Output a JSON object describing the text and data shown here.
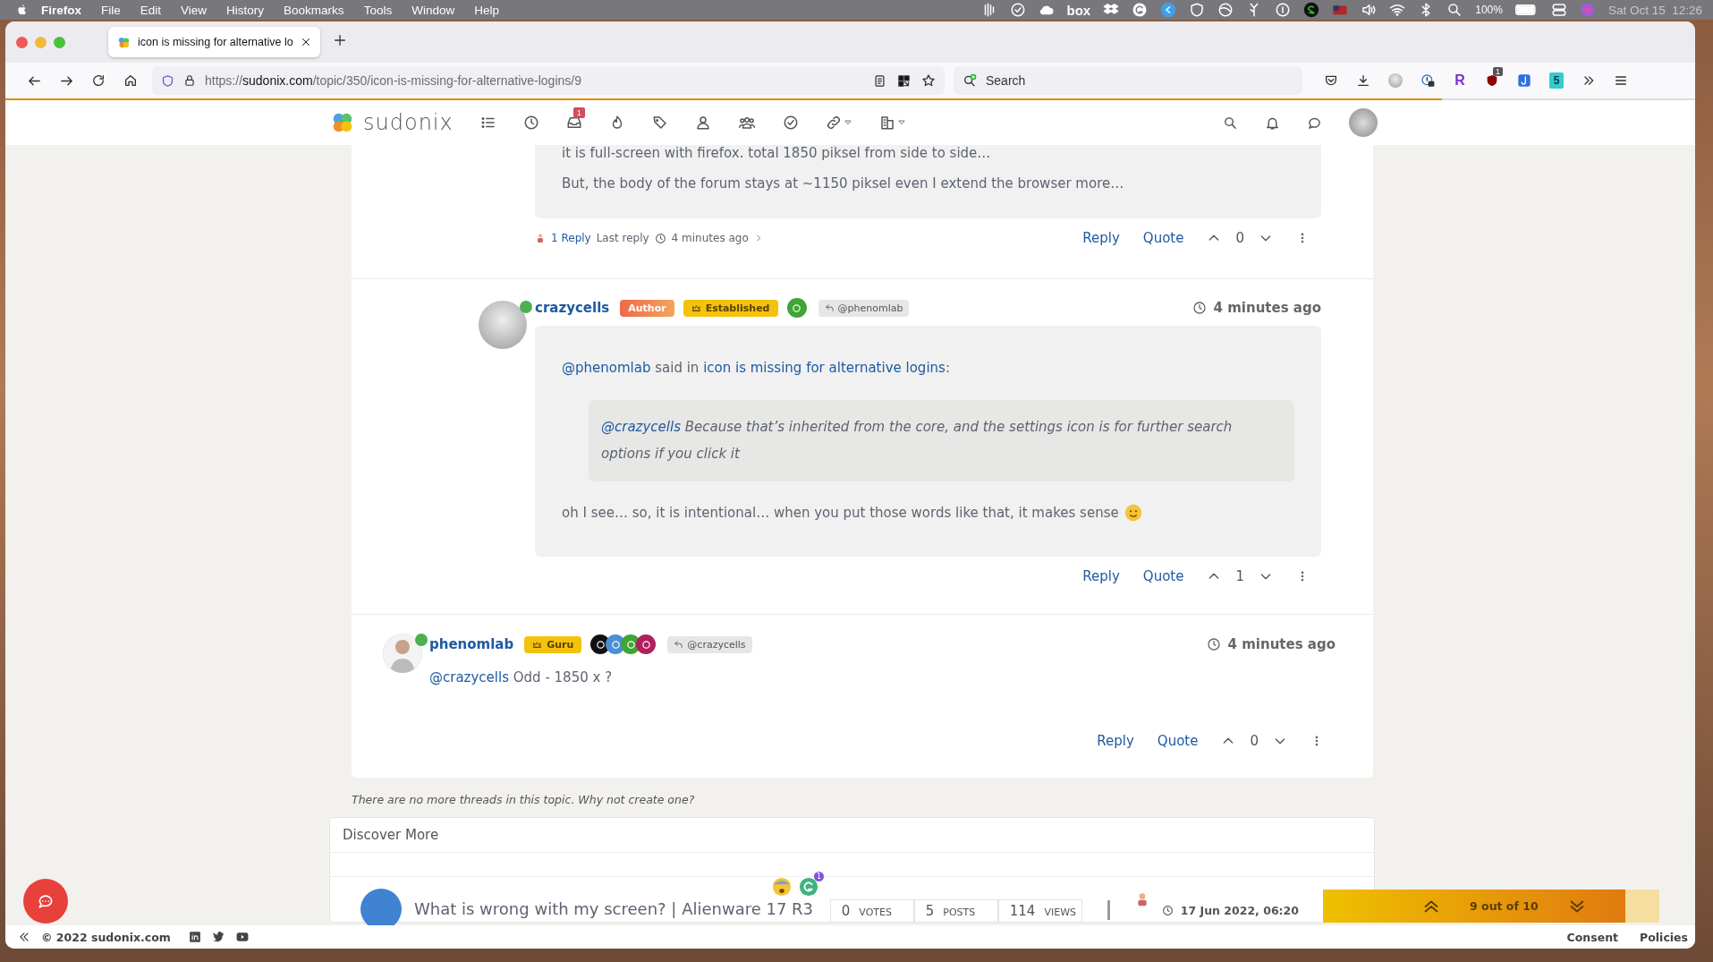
{
  "menubar": {
    "app": "Firefox",
    "menus": [
      "File",
      "Edit",
      "View",
      "History",
      "Bookmarks",
      "Tools",
      "Window",
      "Help"
    ],
    "box_label": "box",
    "battery": "100%",
    "clock": "Sat Oct 15  12:26"
  },
  "browser": {
    "tabs": [
      {
        "title": "icon is missing for alternative lo",
        "selected": true
      }
    ],
    "url": {
      "scheme": "https://",
      "host": "sudonix.com",
      "path": "/topic/350/icon-is-missing-for-alternative-logins/9"
    },
    "search": {
      "placeholder": "Search"
    },
    "extensions": {
      "r_label": "R",
      "badge": "1",
      "five_label": "5"
    },
    "load_progress": {
      "level": 0.85
    }
  },
  "site": {
    "brand": "sudonix",
    "inbox_badge": "1"
  },
  "posts": [
    {
      "kind": "continued",
      "paragraphs": [
        "it is full-screen with firefox. total 1850 piksel from side to side…",
        "But, the body of the forum stays at ~1150 piksel even I extend the browser more…"
      ],
      "replies": "1 Reply",
      "last_reply": "Last reply",
      "last_time": "4 minutes ago",
      "reply": "Reply",
      "quote": "Quote",
      "votes": "0"
    },
    {
      "kind": "bubble",
      "author": "crazycells",
      "online": true,
      "badges": [
        {
          "kind": "author",
          "label": "Author"
        },
        {
          "kind": "rank",
          "label": "Established"
        }
      ],
      "group_icons": [
        {
          "color": "#3fa535"
        }
      ],
      "reply_to": "@phenomlab",
      "time": "4 minutes ago",
      "attribution": {
        "mention": "@phenomlab",
        "middle": "said in",
        "topic": "icon is missing for alternative logins",
        "end": ":"
      },
      "blockquote": {
        "mention": "@crazycells",
        "text": "Because that’s inherited from the core, and the settings icon is for further search options if you click it"
      },
      "text": "oh I see… so, it is intentional… when you put those words like that, it makes sense",
      "smiley": true,
      "reply": "Reply",
      "quote": "Quote",
      "votes": "1"
    },
    {
      "kind": "plain",
      "author": "phenomlab",
      "online": true,
      "badges": [
        {
          "kind": "rank",
          "label": "Guru"
        }
      ],
      "group_icons": [
        {
          "color": "#111111"
        },
        {
          "color": "#4a8fd8"
        },
        {
          "color": "#3fa535"
        },
        {
          "color": "#b01f5e"
        }
      ],
      "reply_to": "@crazycells",
      "time": "4 minutes ago",
      "mention": "@crazycells",
      "text": "Odd - 1850 x ?",
      "reply": "Reply",
      "quote": "Quote",
      "votes": "0"
    }
  ],
  "notice": "There are no more threads in this topic. Why not create one?",
  "discover": {
    "title": "Discover More",
    "topics": [
      {
        "title": "What is wrong with my screen? | Alienware 17 R3",
        "reaction_count": "1",
        "stats": [
          {
            "value": "0",
            "label": "VOTES"
          },
          {
            "value": "5",
            "label": "POSTS"
          },
          {
            "value": "114",
            "label": "VIEWS"
          }
        ],
        "time": "17 Jun 2022, 06:20"
      }
    ]
  },
  "pager": {
    "label": "9 out of 10",
    "level": 0.9
  },
  "footer": {
    "copyright": "© 2022 sudonix.com",
    "links": [
      "Consent",
      "Policies"
    ]
  }
}
